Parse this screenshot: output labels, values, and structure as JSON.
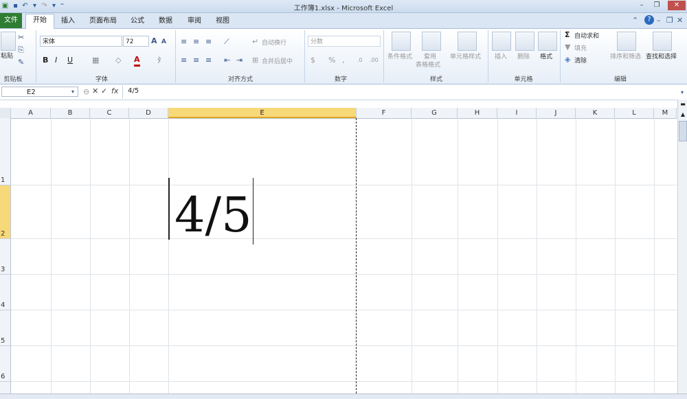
{
  "window": {
    "title": "工作簿1.xlsx - Microsoft Excel"
  },
  "tabs": [
    "文件",
    "开始",
    "插入",
    "页面布局",
    "公式",
    "数据",
    "审阅",
    "视图"
  ],
  "ribbon": {
    "clipboard": {
      "paste": "粘贴",
      "label": "剪贴板"
    },
    "font": {
      "name": "宋体",
      "size": "72",
      "bold": "B",
      "italic": "I",
      "underline": "U",
      "grow": "A",
      "shrink": "A",
      "font_color": "A",
      "label": "字体"
    },
    "alignment": {
      "wrap": "自动换行",
      "merge": "合并后居中",
      "label": "对齐方式"
    },
    "number": {
      "format": "分数",
      "percent": "%",
      "comma": ",",
      "label": "数字"
    },
    "styles": {
      "cond_format": "条件格式",
      "table_format_1": "套用",
      "table_format_2": "表格格式",
      "cell_styles": "单元格样式",
      "label": "样式"
    },
    "cells": {
      "insert": "插入",
      "delete": "删除",
      "format": "格式",
      "label": "单元格"
    },
    "editing": {
      "autosum": "自动求和",
      "fill": "填充",
      "clear": "清除",
      "sort": "排序和筛选",
      "find": "查找和选择",
      "label": "编辑"
    }
  },
  "formula_bar": {
    "name_box": "E2",
    "fx": "fx",
    "content": "4/5"
  },
  "columns": [
    "A",
    "B",
    "C",
    "D",
    "E",
    "F",
    "G",
    "H",
    "I",
    "J",
    "K",
    "L",
    "M"
  ],
  "selected_column": "E",
  "rows": [
    "1",
    "2",
    "3",
    "4",
    "5",
    "6"
  ],
  "selected_row": "2",
  "cell_e2": {
    "value": "4/5"
  },
  "colors": {
    "file_tab": "#2e7d32",
    "selection": "#f8d97a",
    "header_bg": "#f0f3f8"
  }
}
